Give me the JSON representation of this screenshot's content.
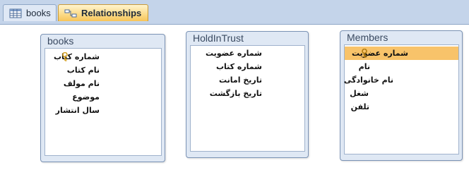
{
  "tabs": [
    {
      "label": "books",
      "icon": "table-icon",
      "active": false
    },
    {
      "label": "Relationships",
      "icon": "relationships-icon",
      "active": true
    }
  ],
  "tables": {
    "books": {
      "title": "books",
      "fields": [
        "شماره کتاب",
        "نام کتاب",
        "نام مولف",
        "موضوع",
        "سال انتشار"
      ],
      "primary_key": "شماره کتاب"
    },
    "holdintrust": {
      "title": "HoldInTrust",
      "fields": [
        "شماره عضویت",
        "شماره کتاب",
        "تاریخ امانت",
        "تاریخ بازگشت"
      ]
    },
    "members": {
      "title": "Members",
      "fields": [
        "شماره عضویت",
        "نام",
        "نام خانوادگی",
        "شغل",
        "تلفن"
      ],
      "primary_key": "شماره عضویت",
      "selected_field": "شماره عضویت"
    }
  },
  "colors": {
    "tabbar": "#c4d4ea",
    "active_tab": "#fbd986",
    "box_border": "#7b93b5",
    "selected_row": "#f8c36a",
    "key_icon": "#d4a020"
  }
}
